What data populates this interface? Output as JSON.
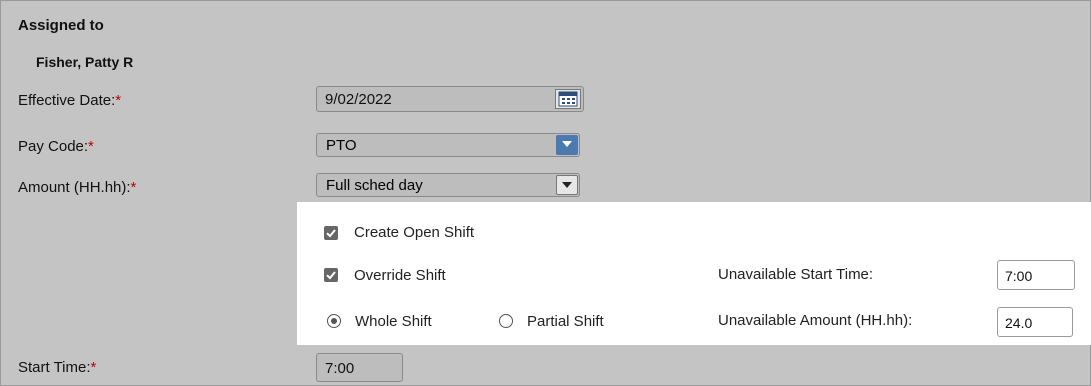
{
  "form": {
    "assigned_to_label": "Assigned to",
    "assigned_to_value": "Fisher, Patty R",
    "effective_date_label": "Effective Date:",
    "effective_date_value": "9/02/2022",
    "pay_code_label": "Pay Code:",
    "pay_code_value": "PTO",
    "amount_label": "Amount (HH.hh):",
    "amount_value": "Full sched day",
    "start_time_label": "Start Time:",
    "start_time_value": "7:00",
    "required_marker": "*"
  },
  "panel": {
    "create_open_shift_label": "Create Open Shift",
    "create_open_shift_checked": true,
    "override_shift_label": "Override Shift",
    "override_shift_checked": true,
    "whole_shift_label": "Whole Shift",
    "partial_shift_label": "Partial Shift",
    "selected_shift_option": "Whole Shift",
    "unavailable_start_time_label": "Unavailable Start Time:",
    "unavailable_start_time_value": "7:00",
    "unavailable_amount_label": "Unavailable Amount (HH.hh):",
    "unavailable_amount_value": "24.0"
  },
  "icons": {
    "calendar": "calendar-icon",
    "dropdown": "chevron-down-icon",
    "checkbox": "checkmark-icon"
  },
  "colors": {
    "background": "#c4c4c4",
    "required": "#c00000",
    "dropdown_accent": "#4a7ab0",
    "panel": "#ffffff"
  }
}
